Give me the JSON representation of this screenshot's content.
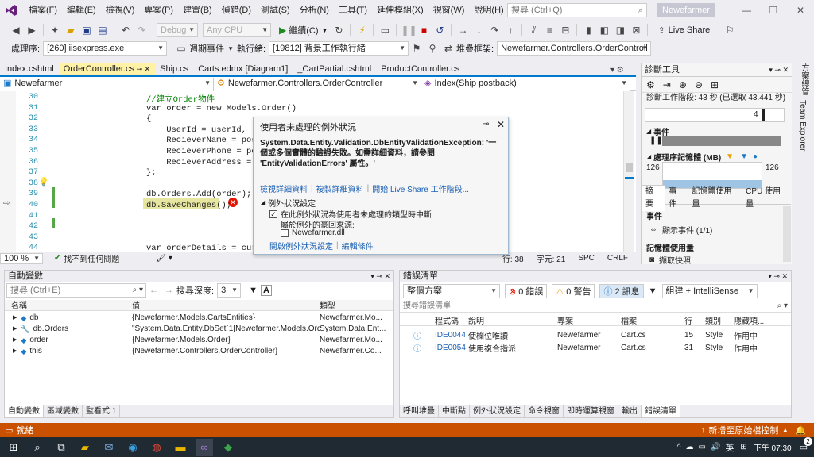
{
  "menu": {
    "items": [
      "檔案(F)",
      "編輯(E)",
      "檢視(V)",
      "專案(P)",
      "建置(B)",
      "偵錯(D)",
      "測試(S)",
      "分析(N)",
      "工具(T)",
      "延伸模組(X)",
      "視窗(W)",
      "說明(H)"
    ],
    "search_placeholder": "搜尋 (Ctrl+Q)",
    "project_name": "Newefarmer"
  },
  "toolbar": {
    "config": "Debug",
    "platform": "Any CPU",
    "continue_label": "繼續(C)",
    "live_share": "Live Share"
  },
  "toolbar2": {
    "process_label": "處理序:",
    "process_value": "[260] iisexpress.exe",
    "lifecycle_label": "週期事件",
    "thread_label": "執行緒:",
    "thread_value": "[19812] 背景工作執行緒",
    "stack_label": "堆疊框架:",
    "stack_value": "Newefarmer.Controllers.OrderControll"
  },
  "tabs": [
    "Index.cshtml",
    "OrderController.cs",
    "Ship.cs",
    "Carts.edmx [Diagram1]",
    "_CartPartial.cshtml",
    "ProductController.cs"
  ],
  "navbar": {
    "project": "Newefarmer",
    "class": "Newefarmer.Controllers.OrderController",
    "method": "Index(Ship postback)"
  },
  "code_lines": [
    {
      "n": "30",
      "t": "//建立Order物件",
      "kind": "comment"
    },
    {
      "n": "31",
      "t": "var order = new Models.Order()",
      "kind": "code"
    },
    {
      "n": "32",
      "t": "{",
      "kind": "code"
    },
    {
      "n": "33",
      "t": "    UserId = userId,",
      "kind": "code"
    },
    {
      "n": "34",
      "t": "    RecieverName = postbac",
      "kind": "code"
    },
    {
      "n": "35",
      "t": "    RecieverPhone = postba",
      "kind": "code"
    },
    {
      "n": "36",
      "t": "    RecieverAddress = pos",
      "kind": "code"
    },
    {
      "n": "37",
      "t": "};",
      "kind": "code"
    },
    {
      "n": "38",
      "t": "",
      "kind": "code"
    },
    {
      "n": "39",
      "t": "db.Orders.Add(order);",
      "kind": "code"
    },
    {
      "n": "40",
      "t": "db.SaveChanges();",
      "kind": "code"
    },
    {
      "n": "41",
      "t": "",
      "kind": "code"
    },
    {
      "n": "42",
      "t": "",
      "kind": "code"
    },
    {
      "n": "43",
      "t": "",
      "kind": "code"
    },
    {
      "n": "44",
      "t": "var orderDetails = curren",
      "kind": "code"
    }
  ],
  "editor_status": {
    "zoom": "100 %",
    "issues": "找不到任何問題",
    "line": "行: 38",
    "char": "字元: 21",
    "spc": "SPC",
    "crlf": "CRLF"
  },
  "exception": {
    "title": "使用者未處理的例外狀況",
    "message": "System.Data.Entity.Validation.DbEntityValidationException: '一個或多個實體的驗證失敗。如需詳細資料，請參閱 'EntityValidationErrors' 屬性。'",
    "link_detail": "檢視詳細資料",
    "link_copy": "複製詳細資料",
    "link_liveshare": "開始 Live Share 工作階段...",
    "settings_title": "例外狀況設定",
    "checkbox1": "在此例外狀況為使用者未處理的類型時中斷",
    "except_label": "屬於例外的豪回來源:",
    "checkbox2": "Newefarmer.dll",
    "link_open": "開啟例外狀況設定",
    "link_edit": "編輯條件"
  },
  "diag": {
    "title": "診斷工具",
    "session": "診斷工作階段: 43 秒 (已選取 43.441 秒)",
    "timeline_tick": "4",
    "events": "事件",
    "memory_label": "處理序記憶體 (MB)",
    "mem_left": "126",
    "mem_right": "126",
    "tabs": [
      "摘要",
      "事件",
      "記憶體使用量",
      "CPU 使用量"
    ],
    "events_heading": "事件",
    "show_events": "顯示事件 (1/1)",
    "memory_heading": "記憶體使用量",
    "snapshot": "擷取快照"
  },
  "vstrip": {
    "labels": [
      "方案總管",
      "Team Explorer"
    ]
  },
  "autos": {
    "title": "自動變數",
    "search_placeholder": "搜尋 (Ctrl+E)",
    "depth_label": "搜尋深度:",
    "depth_value": "3",
    "columns": [
      "名稱",
      "值",
      "類型"
    ],
    "rows": [
      {
        "name": "db",
        "value": "{Newefarmer.Models.CartsEntities}",
        "type": "Newefarmer.Mo..."
      },
      {
        "name": "db.Orders",
        "value": "\"System.Data.Entity.DbSet`1[Newefarmer.Models.Ord...",
        "type": "System.Data.Ent..."
      },
      {
        "name": "order",
        "value": "{Newefarmer.Models.Order}",
        "type": "Newefarmer.Mo..."
      },
      {
        "name": "this",
        "value": "{Newefarmer.Controllers.OrderController}",
        "type": "Newefarmer.Co..."
      }
    ],
    "bottom_tabs": [
      "自動變數",
      "區域變數",
      "監看式 1"
    ]
  },
  "errors": {
    "title": "錯誤清單",
    "scope": "整個方案",
    "errors_btn": "0 錯誤",
    "warnings_btn": "0 警告",
    "messages_btn": "2 訊息",
    "build_filter": "組建 + IntelliSense",
    "search_placeholder": "搜尋錯誤清單",
    "columns": [
      "程式碼",
      "說明",
      "專案",
      "檔案",
      "行",
      "類別",
      "隱藏項..."
    ],
    "rows": [
      {
        "code": "IDE0044",
        "desc": "使欄位唯讀",
        "project": "Newefarmer",
        "file": "Cart.cs",
        "line": "15",
        "category": "Style",
        "hidden": "作用中"
      },
      {
        "code": "IDE0054",
        "desc": "使用複合指派",
        "project": "Newefarmer",
        "file": "Cart.cs",
        "line": "31",
        "category": "Style",
        "hidden": "作用中"
      }
    ],
    "bottom_tabs": [
      "呼叫堆疊",
      "中斷點",
      "例外狀況設定",
      "命令視窗",
      "即時運算視窗",
      "輸出",
      "錯誤清單"
    ]
  },
  "statusbar": {
    "ready": "就緒",
    "source_control": "新增至原始檔控制"
  },
  "taskbar": {
    "lang": "英",
    "time": "下午 07:30",
    "notifications": "2"
  }
}
